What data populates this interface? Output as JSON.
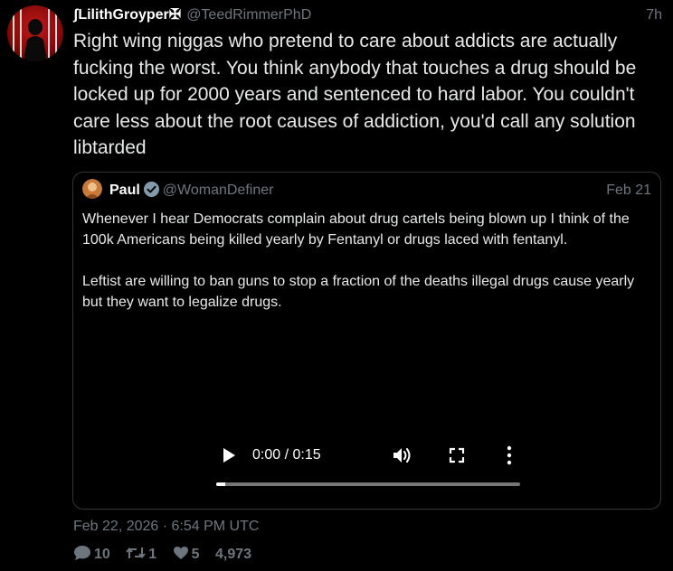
{
  "tweet": {
    "display_name": "ʃLilithGroyper✠",
    "handle": "@TeedRimmerPhD",
    "relative_time": "7h",
    "text": "Right wing niggas who pretend to care about addicts are actually fucking the worst. You think anybody that touches a drug should be locked up for 2000 years and sentenced to hard labor. You couldn't care less about the root causes of addiction, you'd call any solution libtarded",
    "full_date": "Feb 22, 2026 · 6:54 PM UTC",
    "stats": {
      "replies": "10",
      "retweets": "1",
      "likes": "5",
      "views": "4,973"
    }
  },
  "quote": {
    "display_name": "Paul",
    "handle": "@WomanDefiner",
    "date": "Feb 21",
    "paragraph_1": "Whenever I hear Democrats complain about drug cartels being blown up I think of the 100k Americans being killed yearly by Fentanyl or drugs laced with fentanyl.",
    "paragraph_2": "Leftist are willing to ban guns to stop a fraction of the deaths illegal drugs cause yearly but they want to legalize drugs.",
    "video": {
      "time_display": "0:00 / 0:15",
      "progress_fraction": 0.03
    }
  },
  "icons": {
    "verified": "verified-badge-icon",
    "play": "play-icon",
    "volume": "volume-icon",
    "fullscreen": "fullscreen-icon",
    "more": "more-vertical-icon",
    "reply": "comment-icon",
    "retweet": "retweet-icon",
    "like": "heart-icon"
  },
  "colors": {
    "background": "#000000",
    "text": "#e7e9ea",
    "muted": "#6e767d",
    "border": "#333639",
    "verified": "#829aab"
  }
}
